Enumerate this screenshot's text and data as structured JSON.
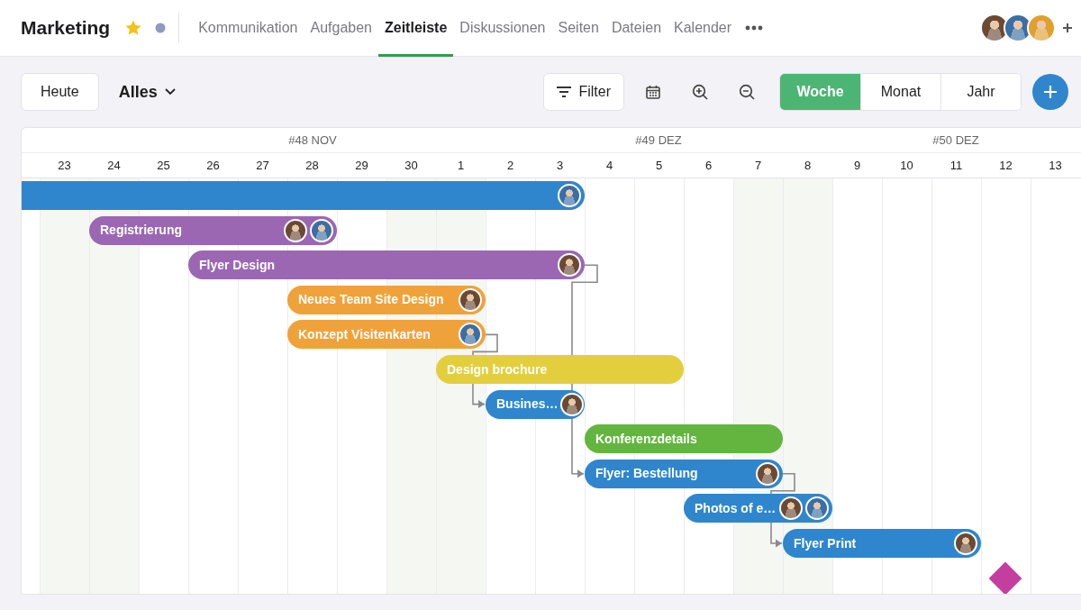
{
  "header": {
    "title": "Marketing",
    "favorite": true,
    "tabs": [
      {
        "label": "Kommunikation",
        "selected": false
      },
      {
        "label": "Aufgaben",
        "selected": false
      },
      {
        "label": "Zeitleiste",
        "selected": true
      },
      {
        "label": "Diskussionen",
        "selected": false
      },
      {
        "label": "Seiten",
        "selected": false
      },
      {
        "label": "Dateien",
        "selected": false
      },
      {
        "label": "Kalender",
        "selected": false
      }
    ],
    "members": [
      {
        "color": "#6b4a35"
      },
      {
        "color": "#3a6ea5"
      },
      {
        "color": "#e0a030"
      }
    ]
  },
  "toolbar": {
    "today": "Heute",
    "scope": "Alles",
    "filter": "Filter",
    "views": [
      {
        "label": "Woche",
        "selected": true
      },
      {
        "label": "Monat",
        "selected": false
      },
      {
        "label": "Jahr",
        "selected": false
      }
    ]
  },
  "timeline": {
    "weeks": [
      "#48 NOV",
      "#49 DEZ",
      "#50 DEZ"
    ],
    "days": [
      "23",
      "24",
      "25",
      "26",
      "27",
      "28",
      "29",
      "30",
      "1",
      "2",
      "3",
      "4",
      "5",
      "6",
      "7",
      "8",
      "9",
      "10",
      "11",
      "12",
      "13"
    ],
    "tasks": [
      {
        "color": "#2f86cc",
        "avatars": [
          {
            "color": "#3a6ea5"
          }
        ]
      },
      {
        "label": "Registrierung",
        "color": "#9b67b3",
        "avatars": [
          {
            "color": "#6b4a35"
          },
          {
            "color": "#3a6ea5"
          }
        ]
      },
      {
        "label": "Flyer Design",
        "color": "#9b67b3",
        "avatars": [
          {
            "color": "#6b4a35"
          }
        ]
      },
      {
        "label": "Neues Team Site Design",
        "color": "#f0a23a",
        "avatars": [
          {
            "color": "#6b4a35"
          }
        ]
      },
      {
        "label": "Konzept Visitenkarten",
        "color": "#f0a23a",
        "avatars": [
          {
            "color": "#3a6ea5"
          }
        ]
      },
      {
        "label": "Design brochure",
        "color": "#e3cf3e"
      },
      {
        "label": "Busines…",
        "color": "#2f86cc",
        "avatars": [
          {
            "color": "#6b4a35"
          }
        ]
      },
      {
        "label": "Konferenzdetails",
        "color": "#63b53f"
      },
      {
        "label": "Flyer: Bestellung",
        "color": "#2f86cc",
        "avatars": [
          {
            "color": "#6b4a35"
          }
        ]
      },
      {
        "label": "Photos of e…",
        "color": "#2f86cc",
        "avatars": [
          {
            "color": "#6b4a35"
          },
          {
            "color": "#3a6ea5"
          }
        ]
      },
      {
        "label": "Flyer Print",
        "color": "#2f86cc",
        "avatars": [
          {
            "color": "#6b4a35"
          }
        ]
      }
    ],
    "milestones": [
      {
        "color": "#c43ea0"
      }
    ]
  }
}
